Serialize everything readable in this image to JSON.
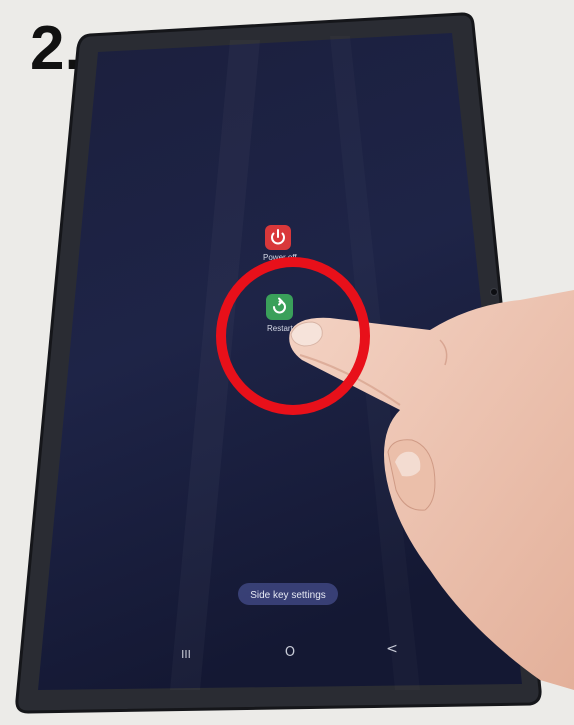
{
  "step_label": "2.",
  "power_menu": {
    "power_off_label": "Power off",
    "restart_label": "Restart",
    "power_off_icon": "power-icon",
    "restart_icon": "restart-icon",
    "power_off_color": "#d9383a",
    "restart_color": "#3aa05a"
  },
  "side_key_button": {
    "label": "Side key settings"
  },
  "nav_bar": {
    "recents_glyph": "III",
    "home_glyph": "O",
    "back_glyph": "<"
  },
  "highlight": {
    "color": "#e8101a"
  }
}
